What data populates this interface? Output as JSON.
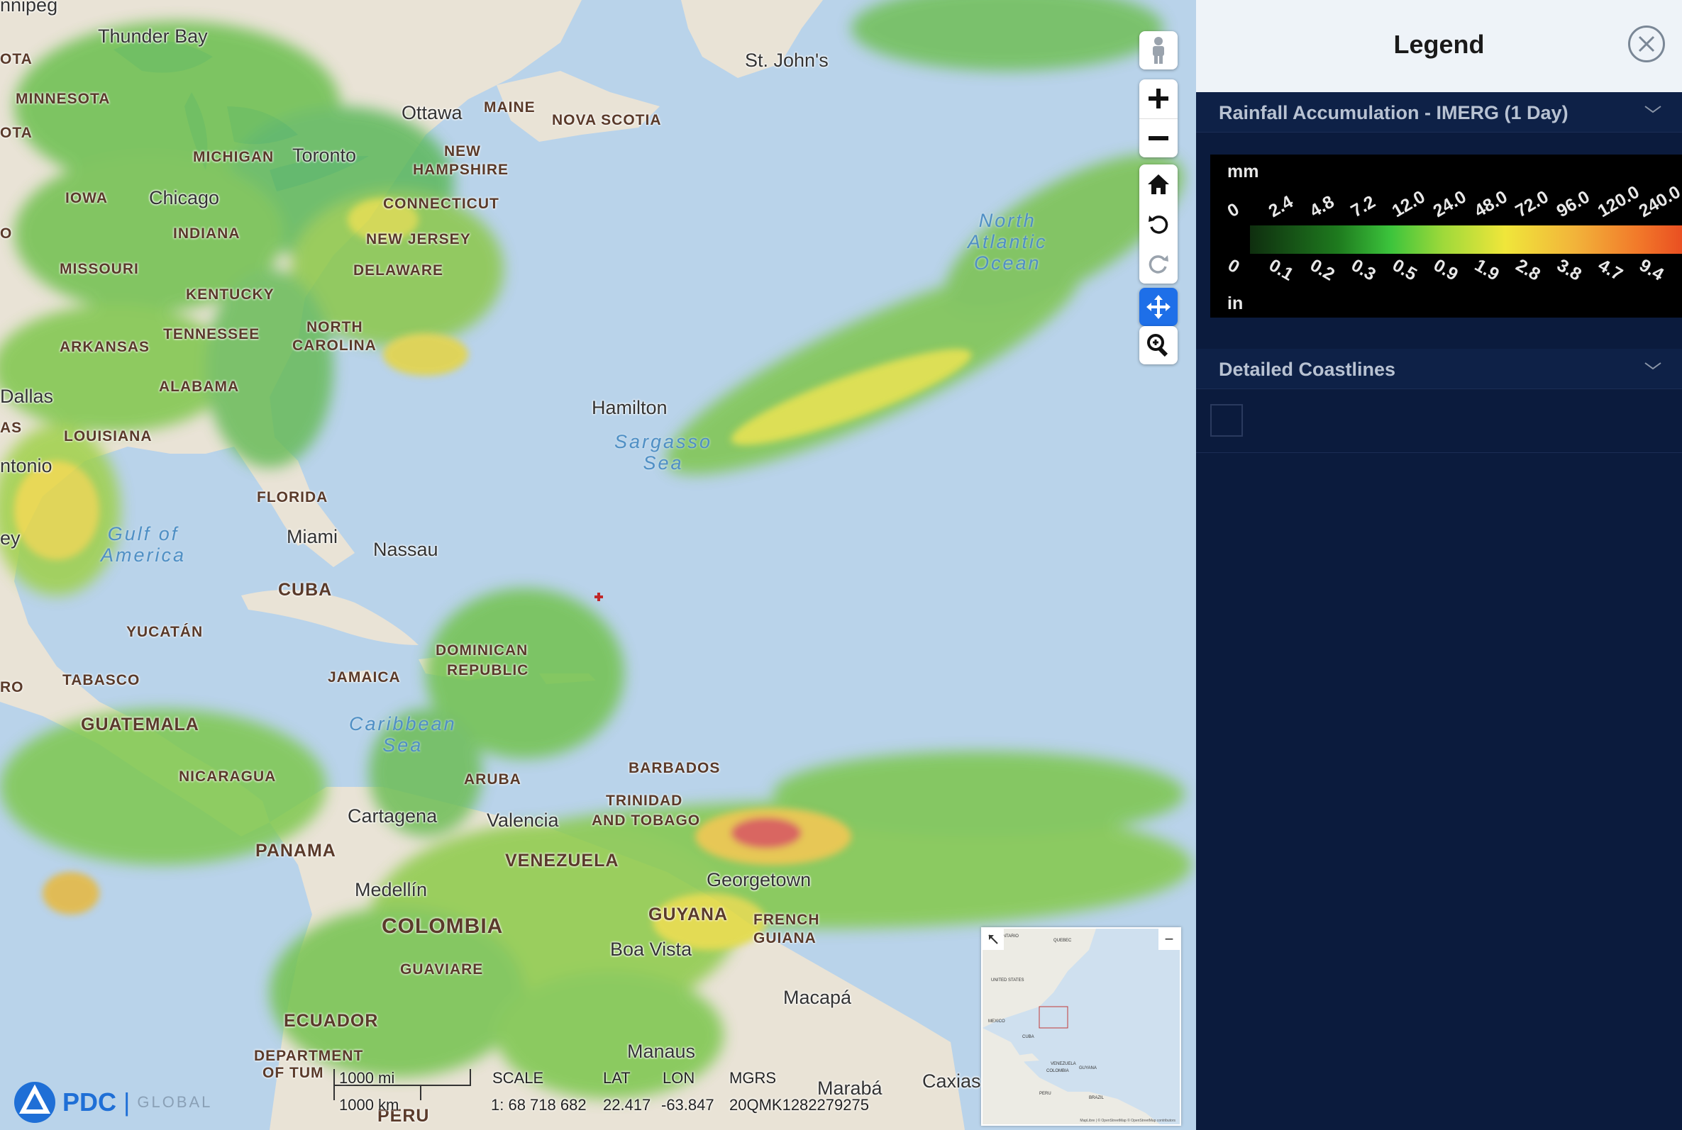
{
  "map": {
    "labels": {
      "thunder_bay": "Thunder Bay",
      "st_johns": "St. John's",
      "minnesota": "MINNESOTA",
      "ota_top": "OTA",
      "ota_mid": "OTA",
      "ottawa": "Ottawa",
      "maine": "MAINE",
      "nova_scotia": "NOVA SCOTIA",
      "michigan": "MICHIGAN",
      "toronto": "Toronto",
      "new_hampshire_1": "NEW",
      "new_hampshire_2": "HAMPSHIRE",
      "iowa": "IOWA",
      "chicago": "Chicago",
      "connecticut": "CONNECTICUT",
      "indiana": "INDIANA",
      "new_jersey": "NEW JERSEY",
      "missouri": "MISSOURI",
      "delaware": "DELAWARE",
      "kentucky": "KENTUCKY",
      "north_carolina_1": "NORTH",
      "north_carolina_2": "CAROLINA",
      "tennessee": "TENNESSEE",
      "arkansas": "ARKANSAS",
      "alabama": "ALABAMA",
      "dallas": "Dallas",
      "as": "AS",
      "louisiana": "LOUISIANA",
      "tonio": "ntonio",
      "hamilton": "Hamilton",
      "florida": "FLORIDA",
      "miami": "Miami",
      "nassau": "Nassau",
      "cuba": "CUBA",
      "yucatan": "YUCATÁN",
      "dominican_1": "DOMINICAN",
      "dominican_2": "REPUBLIC",
      "tabasco": "TABASCO",
      "jamaica": "JAMAICA",
      "guatemala": "GUATEMALA",
      "nicaragua": "NICARAGUA",
      "aruba": "ARUBA",
      "barbados": "BARBADOS",
      "trinidad_1": "TRINIDAD",
      "trinidad_2": "AND TOBAGO",
      "cartagena": "Cartagena",
      "valencia": "Valencia",
      "panama": "PANAMA",
      "venezuela": "VENEZUELA",
      "georgetown": "Georgetown",
      "medellin": "Medellín",
      "colombia": "COLOMBIA",
      "guyana": "GUYANA",
      "french_guiana_1": "FRENCH",
      "french_guiana_2": "GUIANA",
      "boa_vista": "Boa Vista",
      "guaviare": "GUAVIARE",
      "macapa": "Macapá",
      "ecuador": "ECUADOR",
      "manaus": "Manaus",
      "dept_1": "DEPARTMENT",
      "dept_2": "OF TUM",
      "peru": "PERU",
      "maraba": "Marabá",
      "caxias": "Caxias",
      "o_left": "O",
      "ro_left": "RO",
      "ey_left": "ey",
      "nnipeg": "nnipeg"
    },
    "seas": {
      "north_atlantic_1": "North",
      "north_atlantic_2": "Atlantic",
      "north_atlantic_3": "Ocean",
      "sargasso_1": "Sargasso",
      "sargasso_2": "Sea",
      "gulf_1": "Gulf of",
      "gulf_2": "America",
      "caribbean_1": "Caribbean",
      "caribbean_2": "Sea"
    },
    "controls": [
      "pegman-icon",
      "zoom-in-icon",
      "zoom-out-icon",
      "home-icon",
      "rotate-left-icon",
      "rotate-right-icon",
      "pan-icon",
      "zoom-tool-icon"
    ],
    "minimap": {
      "collapse_glyph": "−",
      "labels": [
        "ONTARIO",
        "QUEBEC",
        "UNITED STATES",
        "MEXICO",
        "CUBA",
        "VENEZUELA",
        "COLOMBIA",
        "GUYANA",
        "PERU",
        "BRAZIL"
      ],
      "attribution": "MapLibre | © OpenStreetMap © OpenStreetMap contributors"
    },
    "footer": {
      "brand": "PDC",
      "brand_sub": "GLOBAL",
      "scale_mi": "1000 mi",
      "scale_km": "1000 km",
      "scale_label": "SCALE",
      "scale_value": "1: 68 718 682",
      "lat_label": "LAT",
      "lat_value": "22.417",
      "lon_label": "LON",
      "lon_value": "-63.847",
      "mgrs_label": "MGRS",
      "mgrs_value": "20QMK1282279275"
    }
  },
  "legend": {
    "title": "Legend",
    "sections": [
      {
        "title": "Rainfall Accumulation - IMERG (1 Day)",
        "unit_top": "mm",
        "unit_bottom": "in",
        "mm_ticks": [
          "0",
          "2.4",
          "4.8",
          "7.2",
          "12.0",
          "24.0",
          "48.0",
          "72.0",
          "96.0",
          "120.0",
          "240.0"
        ],
        "in_ticks": [
          "0",
          "0.1",
          "0.2",
          "0.3",
          "0.5",
          "0.9",
          "1.9",
          "2.8",
          "3.8",
          "4.7",
          "9.4"
        ]
      },
      {
        "title": "Detailed Coastlines"
      }
    ]
  }
}
